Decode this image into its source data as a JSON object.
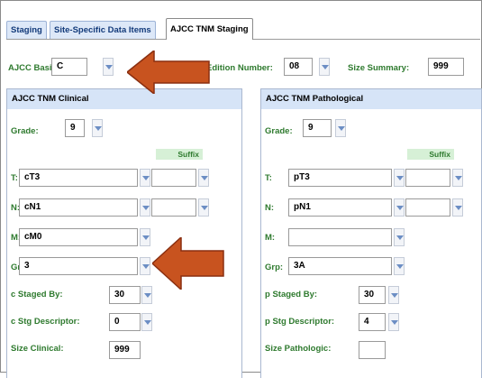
{
  "tabs": [
    "Staging",
    "Site-Specific Data Items",
    "AJCC TNM Staging"
  ],
  "active_tab": "AJCC TNM Staging",
  "top": {
    "basis_label": "AJCC Basis:",
    "basis_value": "C",
    "edition_label": "Edition Number:",
    "edition_value": "08",
    "size_summary_label": "Size Summary:",
    "size_summary_value": "999"
  },
  "clinical": {
    "title": "AJCC TNM Clinical",
    "grade_label": "Grade:",
    "grade_value": "9",
    "suffix_label": "Suffix",
    "t_label": "T:",
    "t_value": "cT3",
    "n_label": "N:",
    "n_value": "cN1",
    "m_label": "M:",
    "m_value": "cM0",
    "grp_label": "Grp:",
    "grp_value": "3",
    "staged_by_label": "c Staged By:",
    "staged_by_value": "30",
    "stg_desc_label": "c Stg Descriptor:",
    "stg_desc_value": "0",
    "size_label": "Size Clinical:",
    "size_value": "999"
  },
  "pathological": {
    "title": "AJCC TNM Pathological",
    "grade_label": "Grade:",
    "grade_value": "9",
    "suffix_label": "Suffix",
    "t_label": "T:",
    "t_value": "pT3",
    "n_label": "N:",
    "n_value": "pN1",
    "m_label": "M:",
    "m_value": "",
    "grp_label": "Grp:",
    "grp_value": "3A",
    "staged_by_label": "p Staged By:",
    "staged_by_value": "30",
    "stg_desc_label": "p Stg Descriptor:",
    "stg_desc_value": "4",
    "size_label": "Size Pathologic:",
    "size_value": ""
  },
  "colors": {
    "label_green": "#2e7a2e",
    "panel_header": "#d6e4f7",
    "arrow": "#c8531f"
  }
}
